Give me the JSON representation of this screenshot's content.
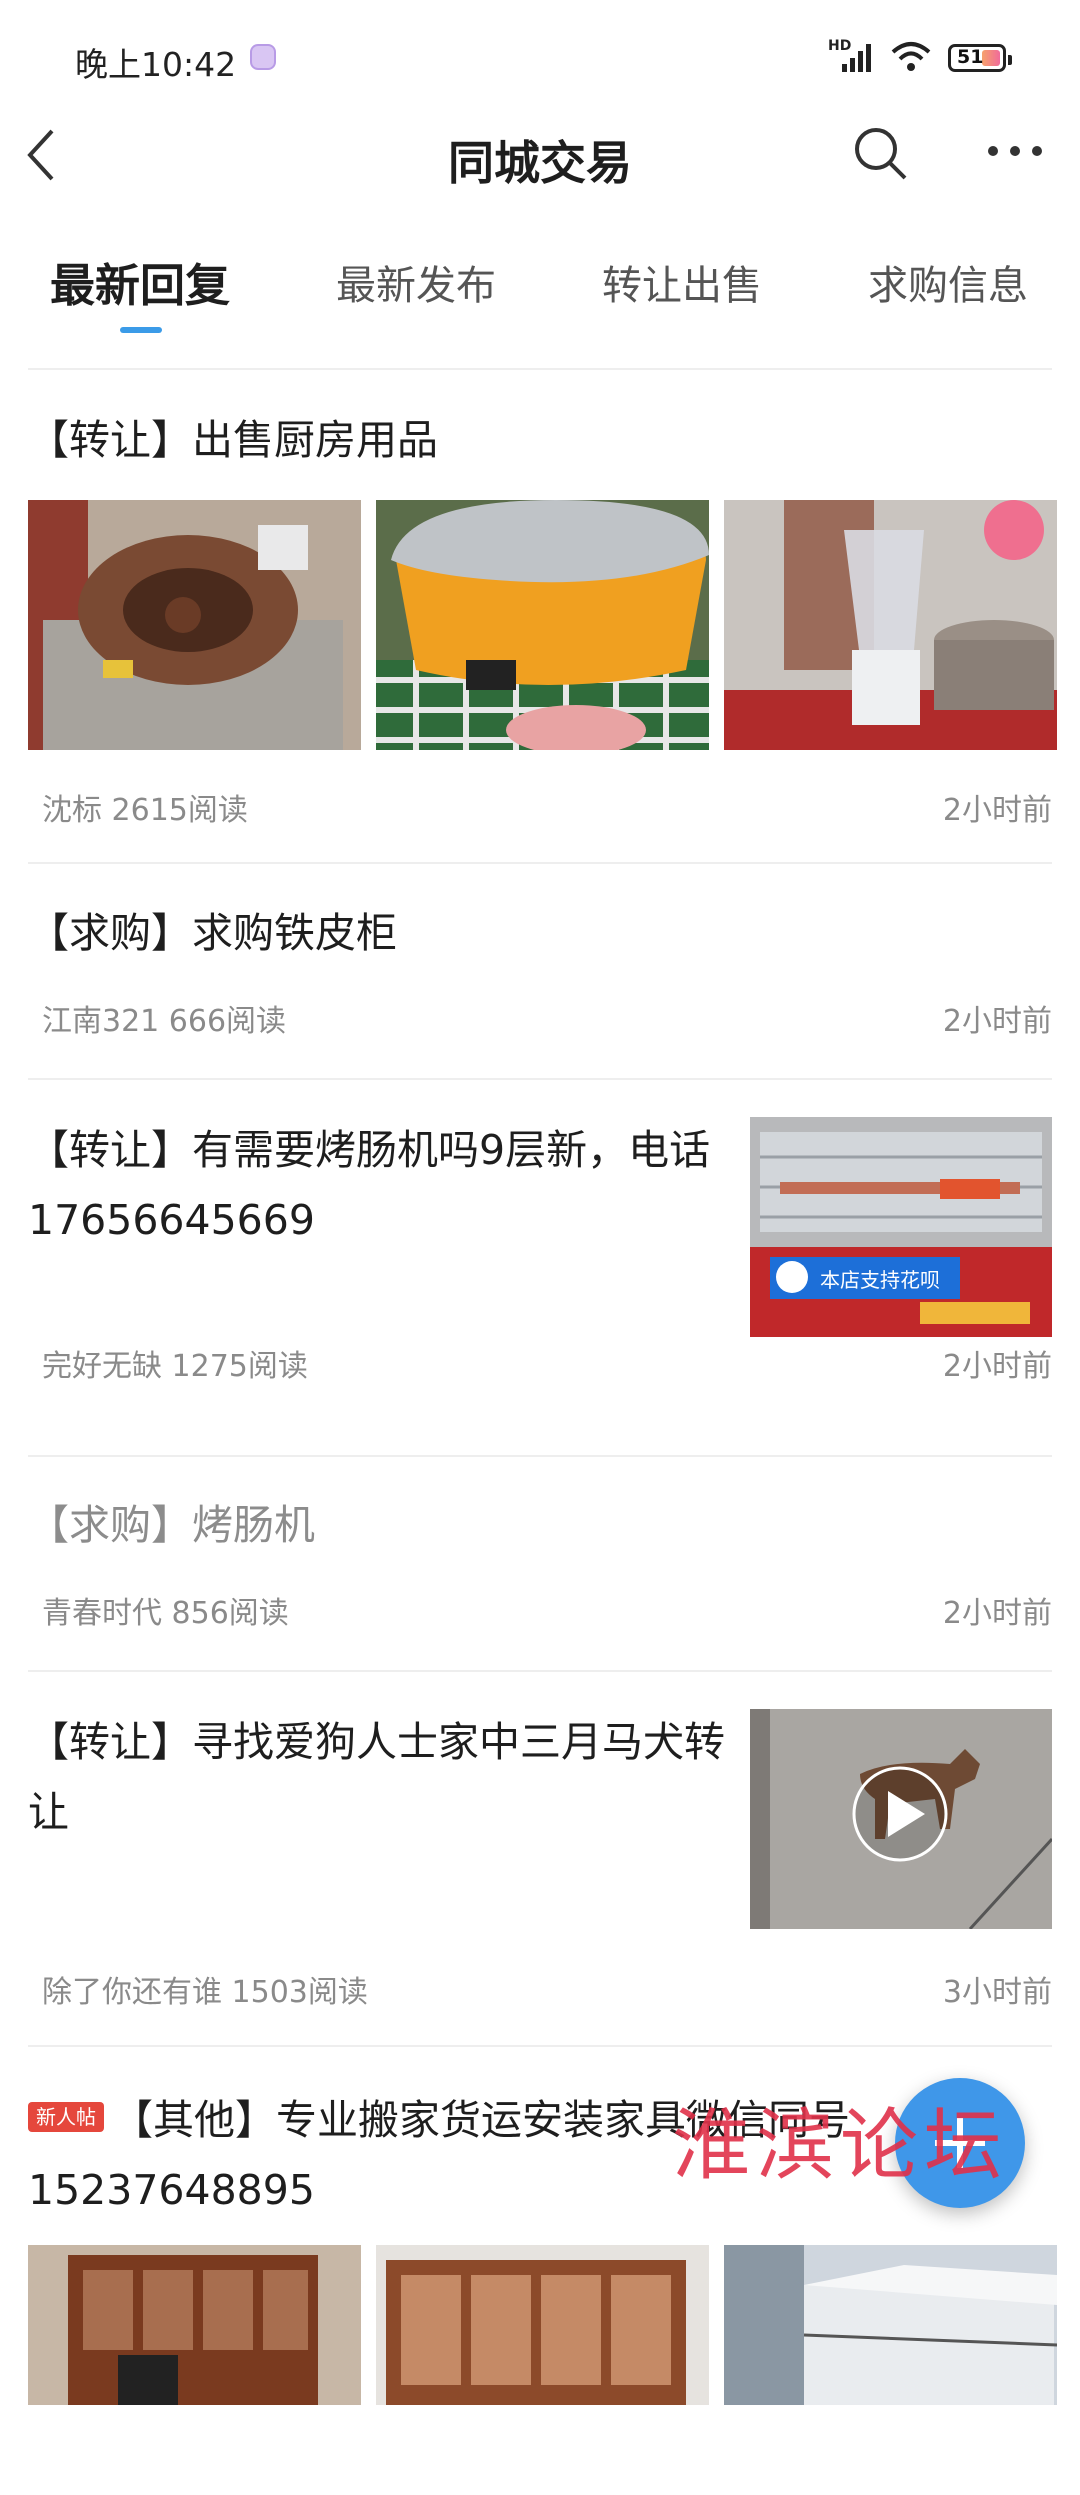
{
  "status": {
    "time": "晚上10:42",
    "network": "HD",
    "battery": "51"
  },
  "nav": {
    "title": "同城交易"
  },
  "tabs": [
    "最新回复",
    "最新发布",
    "转让出售",
    "求购信息"
  ],
  "posts": [
    {
      "title": "【转让】出售厨房用品",
      "meta": "沈标 2615阅读",
      "time": "2小时前"
    },
    {
      "title": "【求购】求购铁皮柜",
      "meta": "江南321 666阅读",
      "time": "2小时前"
    },
    {
      "title": "【转让】有需要烤肠机吗9层新，电话17656645669",
      "meta": "完好无缺 1275阅读",
      "time": "2小时前",
      "image_text": "本店支持花呗"
    },
    {
      "title": "【求购】烤肠机",
      "meta": "青春时代 856阅读",
      "time": "2小时前"
    },
    {
      "title": "【转让】寻找爱狗人士家中三月马犬转让",
      "meta": "除了你还有谁 1503阅读",
      "time": "3小时前"
    },
    {
      "badge": "新人帖",
      "title": "【其他】专业搬家货运安装家具微信同号15237648895"
    }
  ],
  "watermark": "淮滨论坛",
  "colors": {
    "accent": "#3b9be8",
    "badge": "#e5473c",
    "fab": "#3f97e9"
  }
}
